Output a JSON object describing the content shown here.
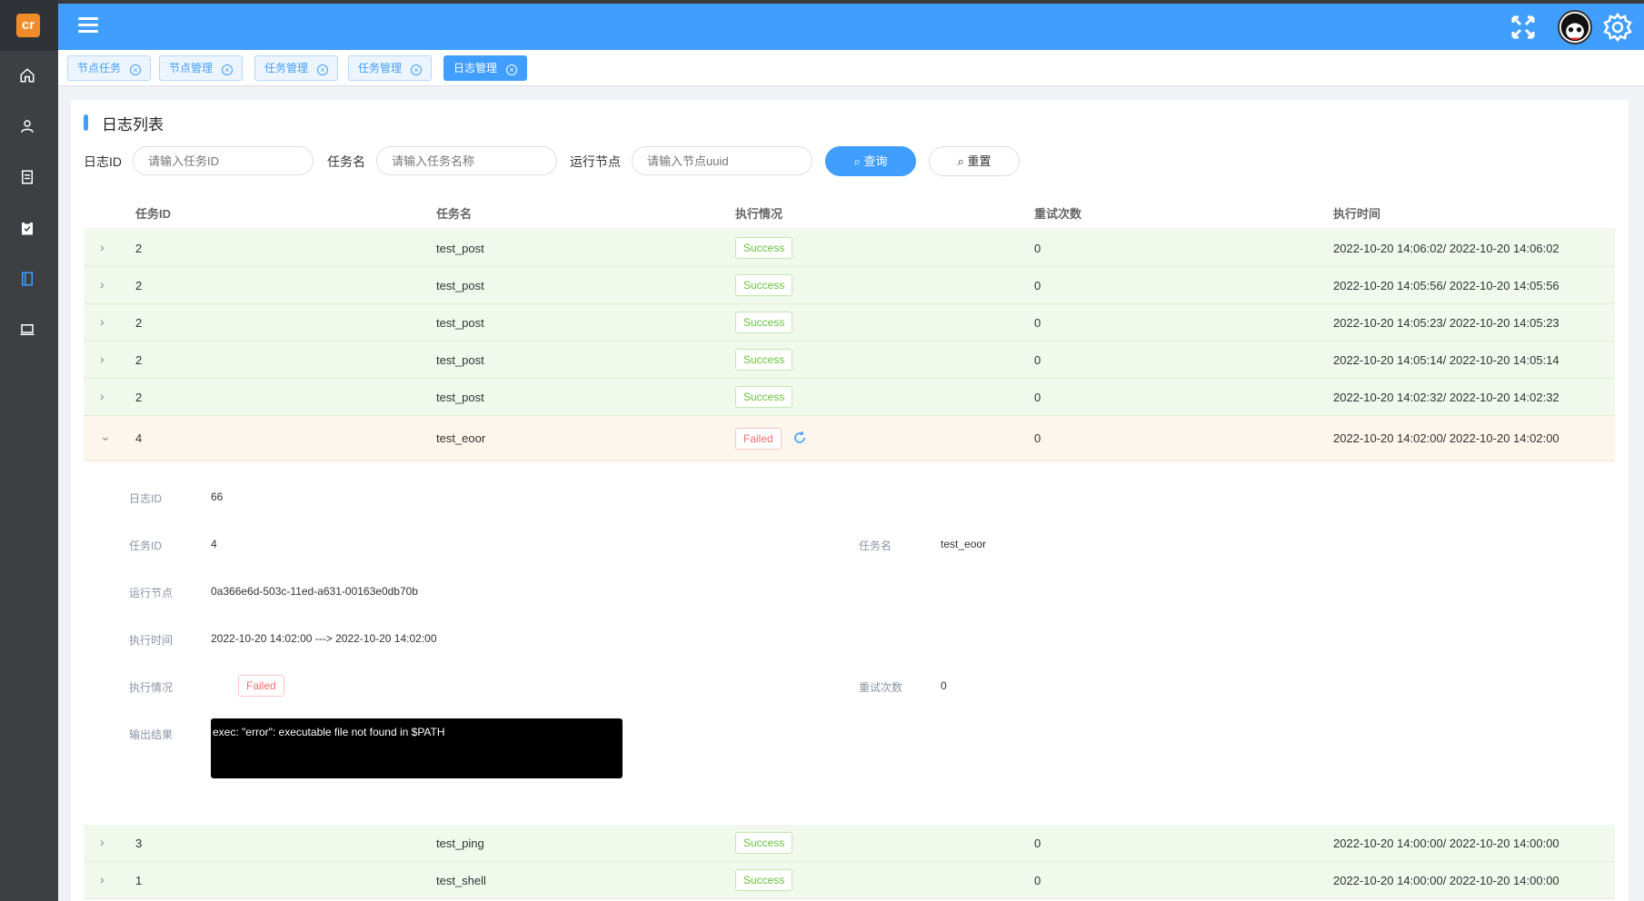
{
  "sidebar": {
    "logo_text": "cr",
    "items": [
      {
        "icon": "home-icon"
      },
      {
        "icon": "user-icon"
      },
      {
        "icon": "document-icon"
      },
      {
        "icon": "clipboard-check-icon"
      },
      {
        "icon": "book-icon",
        "active": true
      },
      {
        "icon": "laptop-icon"
      }
    ]
  },
  "header": {
    "menu_icon": "menu-icon",
    "fullscreen_icon": "fullscreen-icon",
    "settings_icon": "gear-icon"
  },
  "tabs": [
    {
      "label": "节点任务"
    },
    {
      "label": "节点管理"
    },
    {
      "label": "任务管理"
    },
    {
      "label": "任务管理"
    },
    {
      "label": "日志管理",
      "active": true
    }
  ],
  "page": {
    "title": "日志列表"
  },
  "filters": {
    "log_id_label": "日志ID",
    "log_id_placeholder": "请输入任务ID",
    "task_name_label": "任务名",
    "task_name_placeholder": "请输入任务名称",
    "node_label": "运行节点",
    "node_placeholder": "请输入节点uuid",
    "query_label": "查询",
    "reset_label": "重置"
  },
  "table": {
    "headers": {
      "task_id": "任务ID",
      "task_name": "任务名",
      "status": "执行情况",
      "retries": "重试次数",
      "time": "执行时间"
    },
    "rows_top": [
      {
        "task_id": "2",
        "task_name": "test_post",
        "status": "Success",
        "retries": "0",
        "time": "2022-10-20 14:06:02/ 2022-10-20 14:06:02"
      },
      {
        "task_id": "2",
        "task_name": "test_post",
        "status": "Success",
        "retries": "0",
        "time": "2022-10-20 14:05:56/ 2022-10-20 14:05:56"
      },
      {
        "task_id": "2",
        "task_name": "test_post",
        "status": "Success",
        "retries": "0",
        "time": "2022-10-20 14:05:23/ 2022-10-20 14:05:23"
      },
      {
        "task_id": "2",
        "task_name": "test_post",
        "status": "Success",
        "retries": "0",
        "time": "2022-10-20 14:05:14/ 2022-10-20 14:05:14"
      },
      {
        "task_id": "2",
        "task_name": "test_post",
        "status": "Success",
        "retries": "0",
        "time": "2022-10-20 14:02:32/ 2022-10-20 14:02:32"
      }
    ],
    "failed_row": {
      "task_id": "4",
      "task_name": "test_eoor",
      "status": "Failed",
      "retries": "0",
      "time": "2022-10-20 14:02:00/ 2022-10-20 14:02:00"
    },
    "rows_bottom": [
      {
        "task_id": "3",
        "task_name": "test_ping",
        "status": "Success",
        "retries": "0",
        "time": "2022-10-20 14:00:00/ 2022-10-20 14:00:00"
      },
      {
        "task_id": "1",
        "task_name": "test_shell",
        "status": "Success",
        "retries": "0",
        "time": "2022-10-20 14:00:00/ 2022-10-20 14:00:00"
      }
    ]
  },
  "detail": {
    "log_id_label": "日志ID",
    "log_id": "66",
    "task_id_label": "任务ID",
    "task_id": "4",
    "task_name_label": "任务名",
    "task_name": "test_eoor",
    "node_label": "运行节点",
    "node": "0a366e6d-503c-11ed-a631-00163e0db70b",
    "time_label": "执行时间",
    "time": "2022-10-20 14:02:00 ---> 2022-10-20 14:02:00",
    "status_label": "执行情况",
    "status": "Failed",
    "retries_label": "重试次数",
    "retries": "0",
    "output_label": "输出结果",
    "output": "exec: \"error\": executable file not found in $PATH"
  },
  "colors": {
    "primary": "#409eff",
    "success": "#67c23a",
    "danger": "#f56c6c",
    "sidebar": "#3c4043"
  }
}
